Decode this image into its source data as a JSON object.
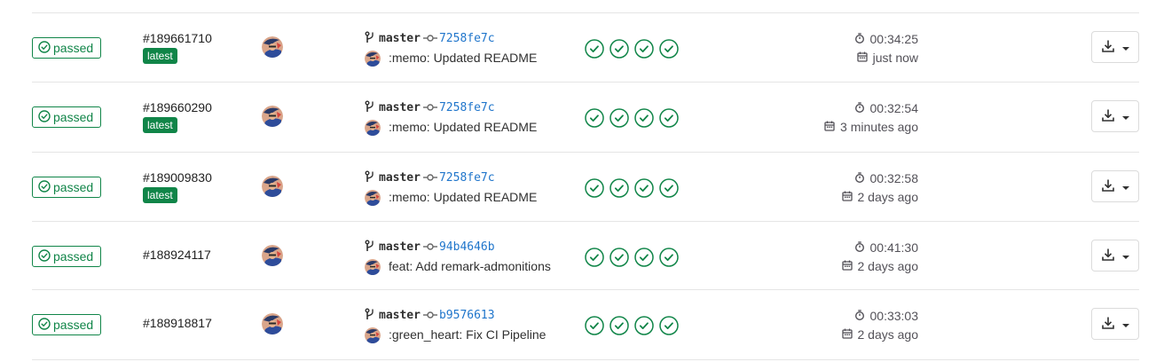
{
  "colors": {
    "success": "#108548",
    "link": "#1f75cb",
    "muted": "#535158",
    "border": "#e5e5e5"
  },
  "icons": {
    "status": "status-success-icon",
    "branch": "branch-icon",
    "commit": "commit-icon",
    "duration": "stopwatch-icon",
    "created": "calendar-icon",
    "download": "download-icon",
    "caret": "chevron-down-icon"
  },
  "pipelines": [
    {
      "status": "passed",
      "id": "#189661710",
      "latest": "latest",
      "branch": "master",
      "sha": "7258fe7c",
      "message": ":memo: Updated README",
      "stages": 4,
      "duration": "00:34:25",
      "finished": "just now"
    },
    {
      "status": "passed",
      "id": "#189660290",
      "latest": "latest",
      "branch": "master",
      "sha": "7258fe7c",
      "message": ":memo: Updated README",
      "stages": 4,
      "duration": "00:32:54",
      "finished": "3 minutes ago"
    },
    {
      "status": "passed",
      "id": "#189009830",
      "latest": "latest",
      "branch": "master",
      "sha": "7258fe7c",
      "message": ":memo: Updated README",
      "stages": 4,
      "duration": "00:32:58",
      "finished": "2 days ago"
    },
    {
      "status": "passed",
      "id": "#188924117",
      "latest": "",
      "branch": "master",
      "sha": "94b4646b",
      "message": "feat: Add remark-admonitions",
      "stages": 4,
      "duration": "00:41:30",
      "finished": "2 days ago"
    },
    {
      "status": "passed",
      "id": "#188918817",
      "latest": "",
      "branch": "master",
      "sha": "b9576613",
      "message": ":green_heart: Fix CI Pipeline",
      "stages": 4,
      "duration": "00:33:03",
      "finished": "2 days ago"
    }
  ]
}
